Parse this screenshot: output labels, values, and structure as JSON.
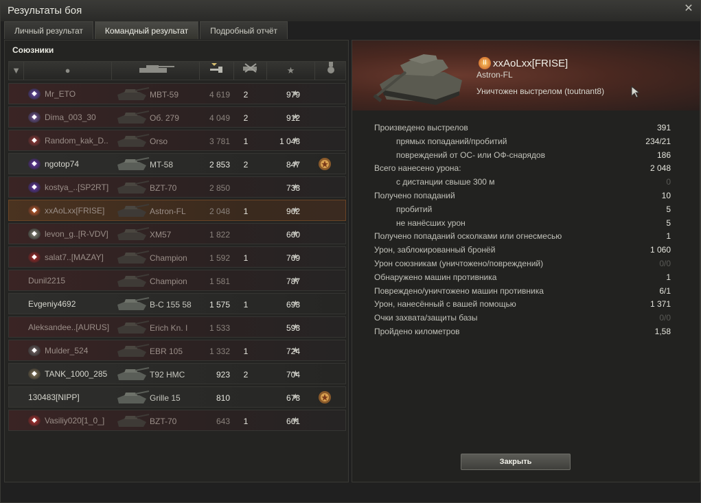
{
  "window": {
    "title": "Результаты боя"
  },
  "tabs": [
    {
      "label": "Личный результат",
      "active": false
    },
    {
      "label": "Командный результат",
      "active": true
    },
    {
      "label": "Подробный отчёт",
      "active": false
    }
  ],
  "allies": {
    "title": "Союзники",
    "header_icons": [
      "platoon-icon",
      "player-icon",
      "vehicle-icon",
      "damage-icon",
      "kills-icon",
      "xp-star-icon",
      "medal-icon"
    ],
    "rows": [
      {
        "name": "Mr_ETO",
        "vehicle": "MBT-59",
        "damage": "4 619",
        "kills": "2",
        "xp": "979",
        "dead": true,
        "badge_color": "#6b4ab0",
        "medal": false
      },
      {
        "name": "Dima_003_30",
        "vehicle": "Об. 279",
        "damage": "4 049",
        "kills": "2",
        "xp": "912",
        "dead": true,
        "badge_color": "#7a5aa0",
        "medal": false
      },
      {
        "name": "Random_kak_D..",
        "vehicle": "Orso",
        "damage": "3 781",
        "kills": "1",
        "xp": "1 043",
        "dead": true,
        "badge_color": "#a03a3a",
        "medal": false
      },
      {
        "name": "ngotop74",
        "vehicle": "MT-58",
        "damage": "2 853",
        "kills": "2",
        "xp": "847",
        "dead": false,
        "badge_color": "#6a3ab0",
        "medal": true
      },
      {
        "name": "kostya_..[SP2RT]",
        "vehicle": "BZT-70",
        "damage": "2 850",
        "kills": "",
        "xp": "733",
        "dead": true,
        "badge_color": "#6a3ab0",
        "medal": false
      },
      {
        "name": "xxAoLxx[FRISE]",
        "vehicle": "Astron-FL",
        "damage": "2 048",
        "kills": "1",
        "xp": "962",
        "dead": true,
        "self": true,
        "badge_color": "#d0602a",
        "medal": false
      },
      {
        "name": "levon_g..[R-VDV]",
        "vehicle": "XM57",
        "damage": "1 822",
        "kills": "",
        "xp": "660",
        "dead": true,
        "badge_color": "#8a8a7a",
        "medal": false
      },
      {
        "name": "salat7..[MAZAY]",
        "vehicle": "Champion",
        "damage": "1 592",
        "kills": "1",
        "xp": "769",
        "dead": true,
        "badge_color": "#b02a2a",
        "medal": false
      },
      {
        "name": "Dunil2215",
        "vehicle": "Champion",
        "damage": "1 581",
        "kills": "",
        "xp": "787",
        "dead": true,
        "badge_color": "",
        "medal": false
      },
      {
        "name": "Evgeniy4692",
        "vehicle": "B-C 155 58",
        "damage": "1 575",
        "kills": "1",
        "xp": "693",
        "dead": false,
        "badge_color": "",
        "medal": false
      },
      {
        "name": "Aleksandee..[AURUS]",
        "vehicle": "Erich Kn. I",
        "damage": "1 533",
        "kills": "",
        "xp": "593",
        "dead": true,
        "badge_color": "",
        "medal": false
      },
      {
        "name": "Mulder_524",
        "vehicle": "EBR 105",
        "damage": "1 332",
        "kills": "1",
        "xp": "724",
        "dead": true,
        "badge_color": "#7a6a6a",
        "medal": false
      },
      {
        "name": "TANK_1000_285",
        "vehicle": "T92 HMC",
        "damage": "923",
        "kills": "2",
        "xp": "704",
        "dead": false,
        "badge_color": "#8a7a5a",
        "medal": false
      },
      {
        "name": "130483[NIPP]",
        "vehicle": "Grille 15",
        "damage": "810",
        "kills": "",
        "xp": "673",
        "dead": false,
        "badge_color": "",
        "medal": true
      },
      {
        "name": "Vasiliy020[1_0_]",
        "vehicle": "BZT-70",
        "damage": "643",
        "kills": "1",
        "xp": "661",
        "dead": true,
        "badge_color": "#c03030",
        "medal": false
      }
    ]
  },
  "detail": {
    "player": "xxAoLxx[FRISE]",
    "vehicle": "Astron-FL",
    "death": "Уничтожен выстрелом (toutnant8)",
    "stats": [
      {
        "label": "Произведено выстрелов",
        "value": "391",
        "sub": false,
        "dim": false
      },
      {
        "label": "прямых попаданий/пробитий",
        "value": "234/21",
        "sub": true,
        "dim": false
      },
      {
        "label": "повреждений от ОС- или ОФ-снарядов",
        "value": "186",
        "sub": true,
        "dim": false
      },
      {
        "label": "Всего нанесено урона:",
        "value": "2 048",
        "sub": false,
        "dim": false
      },
      {
        "label": "с дистанции свыше 300 м",
        "value": "0",
        "sub": true,
        "dim": true
      },
      {
        "label": "Получено попаданий",
        "value": "10",
        "sub": false,
        "dim": false
      },
      {
        "label": "пробитий",
        "value": "5",
        "sub": true,
        "dim": false
      },
      {
        "label": "не нанёсших урон",
        "value": "5",
        "sub": true,
        "dim": false
      },
      {
        "label": "Получено попаданий осколками или огнесмесью",
        "value": "1",
        "sub": false,
        "dim": false
      },
      {
        "label": "Урон, заблокированный бронёй",
        "value": "1 060",
        "sub": false,
        "dim": false
      },
      {
        "label": "Урон союзникам (уничтожено/повреждений)",
        "value": "0/0",
        "sub": false,
        "dim": true
      },
      {
        "label": "Обнаружено машин противника",
        "value": "1",
        "sub": false,
        "dim": false
      },
      {
        "label": "Повреждено/уничтожено машин противника",
        "value": "6/1",
        "sub": false,
        "dim": false
      },
      {
        "label": "Урон, нанесённый с вашей помощью",
        "value": "1 371",
        "sub": false,
        "dim": false
      },
      {
        "label": "Очки захвата/защиты базы",
        "value": "0/0",
        "sub": false,
        "dim": true
      },
      {
        "label": "Пройдено километров",
        "value": "1,58",
        "sub": false,
        "dim": false
      }
    ],
    "close_label": "Закрыть"
  }
}
